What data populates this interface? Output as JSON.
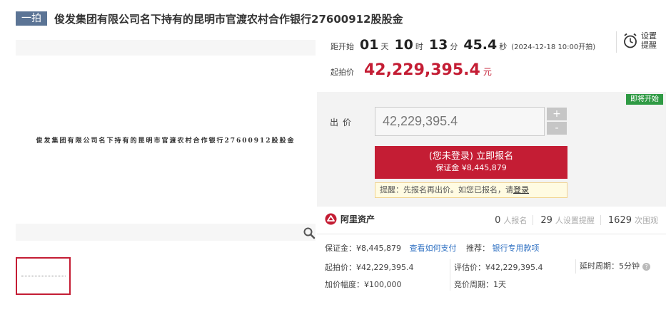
{
  "header": {
    "tag": "一拍",
    "title": "俊发集团有限公司名下持有的昆明市官渡农村合作银行27600912股股金"
  },
  "media": {
    "caption": "俊发集团有限公司名下持有的昆明市官渡农村合作银行27600912股股金"
  },
  "countdown": {
    "label": "距开始",
    "days": "01",
    "days_unit": "天",
    "hours": "10",
    "hours_unit": "时",
    "minutes": "13",
    "minutes_unit": "分",
    "seconds": "45.4",
    "seconds_unit": "秒",
    "start_note": "(2024-12-18 10:00开拍)"
  },
  "alarm": {
    "line1": "设置",
    "line2": "提醒"
  },
  "start_price": {
    "label": "起拍价",
    "value": "42,229,395.4",
    "unit": "元"
  },
  "bid": {
    "badge": "即将开始",
    "label": "出价",
    "input_value": "42,229,395.4",
    "plus": "+",
    "minus": "-",
    "register_main": "(您未登录) 立即报名",
    "register_sub": "保证金 ¥8,445,879",
    "tip_text": "提醒：先报名再出价。如您已报名，请",
    "tip_link": "登录"
  },
  "platform": {
    "name": "阿里资产"
  },
  "stats": {
    "signups": "0",
    "signups_label": "人报名",
    "reminders": "29",
    "reminders_label": "人设置提醒",
    "views": "1629",
    "views_label": "次围观"
  },
  "details": {
    "deposit": "保证金：¥8,445,879",
    "how_to_pay": "查看如何支付",
    "recommend_label": "推荐：",
    "bank_link": "银行专用款项",
    "start_price": "起拍价：¥42,229,395.4",
    "appraisal": "评估价：¥42,229,395.4",
    "delay_cycle": "延时周期：5分钟",
    "increment": "加价幅度：¥100,000",
    "auction_cycle": "竞价周期：1天"
  },
  "colors": {
    "accent_red": "#c41d34",
    "badge_green": "#2f9a44",
    "link_blue": "#2b6ec1",
    "tag_blue": "#5b7495"
  }
}
